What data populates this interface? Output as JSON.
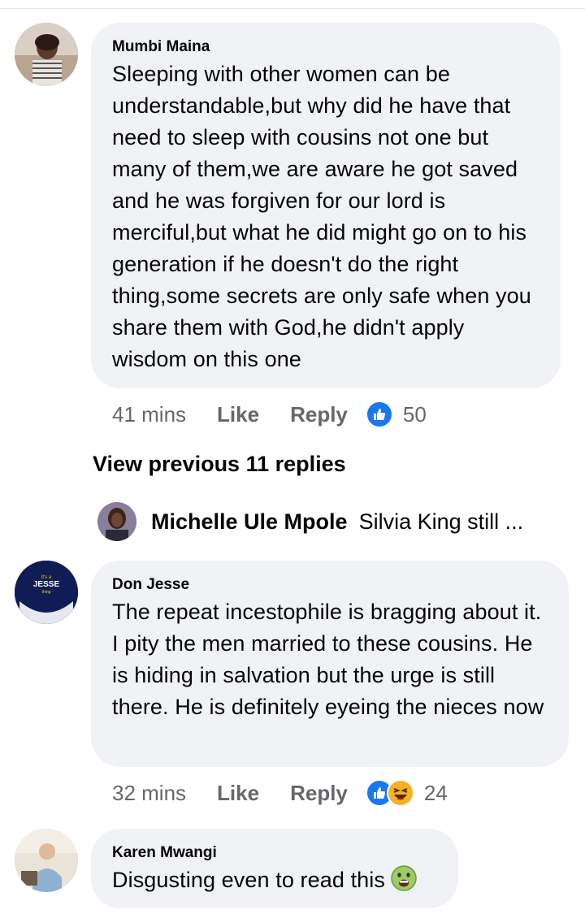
{
  "comments": [
    {
      "author": "Mumbi Maina",
      "text": "Sleeping  with other women can be understandable,but why did he have that need to sleep with cousins not one but many of them,we are aware he got saved and he was forgiven for our lord is merciful,but  what he did might go on to his generation if he doesn't do the right thing,some secrets are only safe when you share them with God,he didn't apply wisdom on this one",
      "time": "41 mins",
      "like_label": "Like",
      "reply_label": "Reply",
      "reactions": [
        "like-icon"
      ],
      "reaction_count": "50"
    },
    {
      "author": "Don Jesse",
      "text": "The repeat incestophile is bragging about it. I pity the men married to these cousins. He is hiding in salvation but the urge is still there. He is definitely eyeing the nieces now",
      "time": "32 mins",
      "like_label": "Like",
      "reply_label": "Reply",
      "reactions": [
        "like-icon",
        "haha-icon"
      ],
      "reaction_count": "24"
    },
    {
      "author": "Karen Mwangi",
      "text": "Disgusting even to read this",
      "emoji": "nauseated-face-icon"
    }
  ],
  "view_previous_replies": "View previous 11 replies",
  "reply_preview": {
    "author": "Michelle Ule Mpole",
    "text": "Silvia King still ..."
  },
  "avatar_logo_text": {
    "line1": "It's a",
    "line2": "JESSE",
    "line3": "thing"
  },
  "colors": {
    "bubble": "#f0f2f5",
    "meta_text": "#65676b",
    "like_blue": "#1877f2",
    "haha_yellow": "#f7b125"
  }
}
